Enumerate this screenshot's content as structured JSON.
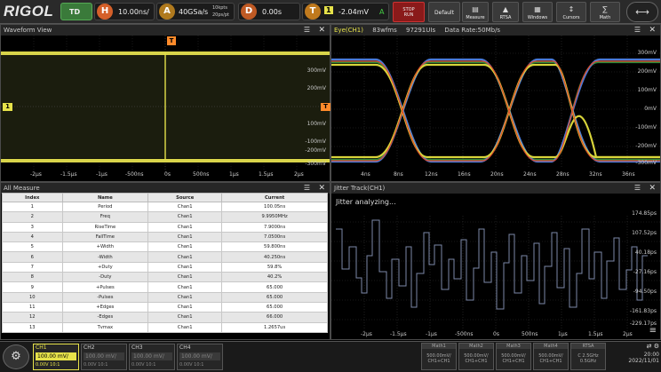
{
  "topbar": {
    "logo": "RIGOL",
    "td": "TD",
    "h_badge": "H",
    "timebase": "10.00ns/",
    "a_badge": "A",
    "sample_rate": "40GSa/s",
    "mem_depth": "10kpts",
    "pts_rate": "20ps/pt",
    "d_badge": "D",
    "delay": "0.00s",
    "t_badge": "T",
    "trig_src": "1",
    "trig_level": "-2.04mV",
    "trig_suffix": "A",
    "buttons": [
      {
        "label": "STOP\nRUN"
      },
      {
        "label": "Default"
      },
      {
        "label": "Measure"
      },
      {
        "label": "RTSA"
      },
      {
        "label": "Windows"
      },
      {
        "label": "Cursors"
      },
      {
        "label": "Math"
      }
    ]
  },
  "waveform": {
    "title": "Waveform View",
    "y_ticks": [
      "300mV",
      "200mV",
      "100mV",
      "-100mV",
      "-200mV",
      "-300mV"
    ],
    "x_ticks": [
      "-2µs",
      "-1.5µs",
      "-1µs",
      "-500ns",
      "0s",
      "500ns",
      "1µs",
      "1.5µs",
      "2µs"
    ],
    "ch_marker": "1",
    "trig_marker": "T"
  },
  "eye": {
    "title": "Eye(CH1)",
    "wfms": "83wfms",
    "uis": "97291UIs",
    "data_rate": "Data Rate:50Mb/s",
    "y_ticks": [
      "300mV",
      "200mV",
      "100mV",
      "0mV",
      "-100mV",
      "-200mV",
      "-300mV"
    ],
    "x_ticks": [
      "4ns",
      "8ns",
      "12ns",
      "16ns",
      "20ns",
      "24ns",
      "28ns",
      "32ns",
      "36ns"
    ]
  },
  "measure": {
    "title": "All Measure",
    "columns": [
      "Index",
      "Name",
      "Source",
      "Current"
    ],
    "rows": [
      [
        "1",
        "Period",
        "Chan1",
        "100.05ns"
      ],
      [
        "2",
        "Freq",
        "Chan1",
        "9.9950MHz"
      ],
      [
        "3",
        "RiseTime",
        "Chan1",
        "7.9000ns"
      ],
      [
        "4",
        "FallTime",
        "Chan1",
        "7.0500ns"
      ],
      [
        "5",
        "+Width",
        "Chan1",
        "59.800ns"
      ],
      [
        "6",
        "-Width",
        "Chan1",
        "40.250ns"
      ],
      [
        "7",
        "+Duty",
        "Chan1",
        "59.8%"
      ],
      [
        "8",
        "-Duty",
        "Chan1",
        "40.2%"
      ],
      [
        "9",
        "+Pulses",
        "Chan1",
        "65.000"
      ],
      [
        "10",
        "-Pulses",
        "Chan1",
        "65.000"
      ],
      [
        "11",
        "+Edges",
        "Chan1",
        "65.000"
      ],
      [
        "12",
        "-Edges",
        "Chan1",
        "66.000"
      ],
      [
        "13",
        "Tvmax",
        "Chan1",
        "1.2657us"
      ]
    ]
  },
  "jitter": {
    "title": "Jitter Track(CH1)",
    "status": "Jitter analyzing...",
    "y_ticks": [
      "174.85ps",
      "107.52ps",
      "40.18ps",
      "-27.16ps",
      "-94.50ps",
      "-161.83ps",
      "-229.17ps"
    ],
    "x_ticks": [
      "-2µs",
      "-1.5µs",
      "-1µs",
      "-500ns",
      "0s",
      "500ns",
      "1µs",
      "1.5µs",
      "2µs"
    ]
  },
  "channels": [
    {
      "name": "CH1",
      "value": "100.00 mV/",
      "sub": "0.00V  10:1"
    },
    {
      "name": "CH2",
      "value": "100.00 mV/",
      "sub": "0.00V  10:1"
    },
    {
      "name": "CH3",
      "value": "100.00 mV/",
      "sub": "0.00V  10:1"
    },
    {
      "name": "CH4",
      "value": "100.00 mV/",
      "sub": "0.00V  10:1"
    }
  ],
  "maths": [
    {
      "name": "Math1",
      "value": "500.00mV/",
      "sub": "CH1+CH1"
    },
    {
      "name": "Math2",
      "value": "500.00mV/",
      "sub": "CH1+CH1"
    },
    {
      "name": "Math3",
      "value": "500.00mV/",
      "sub": "CH1+CH1"
    },
    {
      "name": "Math4",
      "value": "500.00mV/",
      "sub": "CH1+CH1"
    },
    {
      "name": "RTSA",
      "value": "C 2.5GHz",
      "sub": "0.5GHz"
    }
  ],
  "clock": {
    "time": "20:00",
    "date": "2022/11/01"
  },
  "colors": {
    "ch1": "#e6e24a",
    "trig": "#ff8a2a",
    "accent_blue": "#2c6fd6"
  }
}
